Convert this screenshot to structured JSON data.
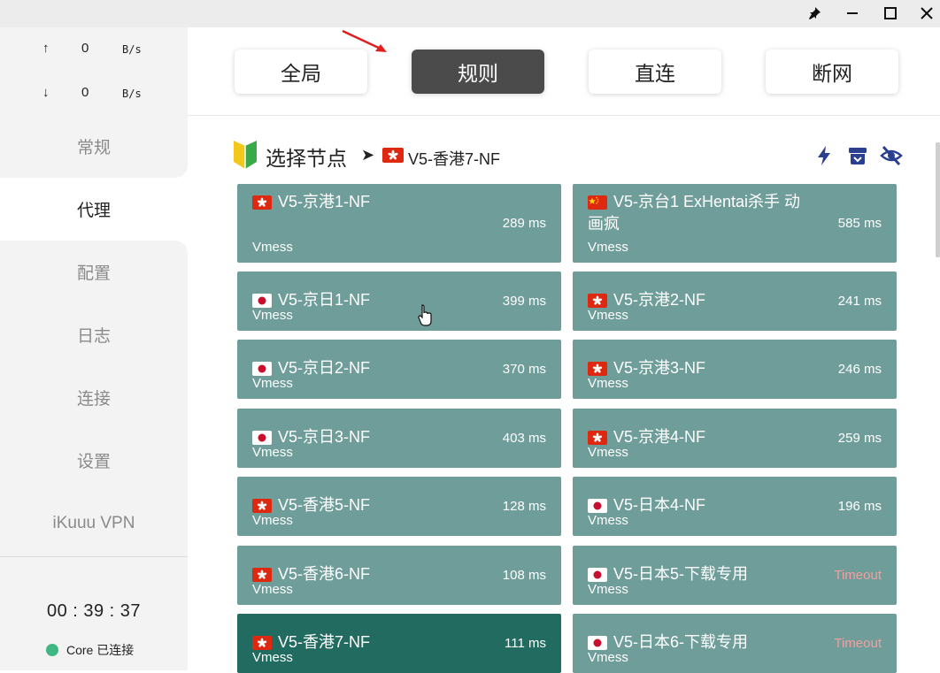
{
  "window": {
    "pin_icon": "pin-icon",
    "minimize_icon": "minimize-icon",
    "maximize_icon": "maximize-icon",
    "close_icon": "close-icon"
  },
  "traffic": {
    "up_arrow": "↑",
    "up_value": "0",
    "up_unit": "B/s",
    "down_arrow": "↓",
    "down_value": "0",
    "down_unit": "B/s"
  },
  "sidebar": {
    "items": [
      {
        "label": "常规"
      },
      {
        "label": "代理"
      },
      {
        "label": "配置"
      },
      {
        "label": "日志"
      },
      {
        "label": "连接"
      },
      {
        "label": "设置"
      },
      {
        "label": "iKuuu VPN"
      }
    ],
    "active_index": 1,
    "timer": "00 : 39 : 37",
    "core_status": "Core 已连接",
    "core_color": "#3fb782"
  },
  "modes": [
    {
      "label": "全局"
    },
    {
      "label": "规则"
    },
    {
      "label": "直连"
    },
    {
      "label": "断网"
    }
  ],
  "active_mode_index": 1,
  "section": {
    "title": "选择节点",
    "arrow": "➤",
    "current_node": "V5-香港7-NF",
    "current_flag": "hk",
    "icons": [
      "lightning-icon",
      "archive-icon",
      "eye-off-icon"
    ]
  },
  "colors": {
    "card": "#6e9d9a",
    "card_selected": "#226b60",
    "timeout": "#f0a0a0",
    "mode_active": "#4b4b4b",
    "icon_blue": "#2a3f8f"
  },
  "nodes": [
    {
      "name": "V5-京港1-NF",
      "flag": "hk",
      "protocol": "Vmess",
      "delay": "289 ms",
      "selected": false
    },
    {
      "name": "V5-京台1 ExHentai杀手 动画疯",
      "flag": "cn",
      "protocol": "Vmess",
      "delay": "585 ms",
      "selected": false
    },
    {
      "name": "V5-京日1-NF",
      "flag": "jp",
      "protocol": "Vmess",
      "delay": "399 ms",
      "selected": false
    },
    {
      "name": "V5-京港2-NF",
      "flag": "hk",
      "protocol": "Vmess",
      "delay": "241 ms",
      "selected": false
    },
    {
      "name": "V5-京日2-NF",
      "flag": "jp",
      "protocol": "Vmess",
      "delay": "370 ms",
      "selected": false
    },
    {
      "name": "V5-京港3-NF",
      "flag": "hk",
      "protocol": "Vmess",
      "delay": "246 ms",
      "selected": false
    },
    {
      "name": "V5-京日3-NF",
      "flag": "jp",
      "protocol": "Vmess",
      "delay": "403 ms",
      "selected": false
    },
    {
      "name": "V5-京港4-NF",
      "flag": "hk",
      "protocol": "Vmess",
      "delay": "259 ms",
      "selected": false
    },
    {
      "name": "V5-香港5-NF",
      "flag": "hk",
      "protocol": "Vmess",
      "delay": "128 ms",
      "selected": false
    },
    {
      "name": "V5-日本4-NF",
      "flag": "jp",
      "protocol": "Vmess",
      "delay": "196 ms",
      "selected": false
    },
    {
      "name": "V5-香港6-NF",
      "flag": "hk",
      "protocol": "Vmess",
      "delay": "108 ms",
      "selected": false
    },
    {
      "name": "V5-日本5-下载专用",
      "flag": "jp",
      "protocol": "Vmess",
      "delay": "Timeout",
      "selected": false
    },
    {
      "name": "V5-香港7-NF",
      "flag": "hk",
      "protocol": "Vmess",
      "delay": "111 ms",
      "selected": true
    },
    {
      "name": "V5-日本6-下载专用",
      "flag": "jp",
      "protocol": "Vmess",
      "delay": "Timeout",
      "selected": false
    }
  ]
}
